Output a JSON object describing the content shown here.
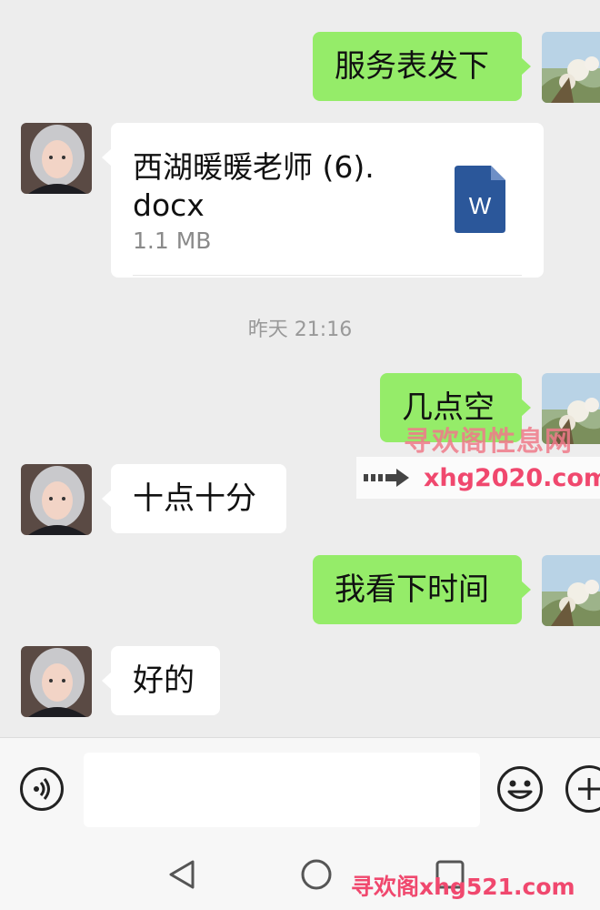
{
  "messages": [
    {
      "side": "right",
      "text": "服务表发下"
    },
    {
      "side": "left",
      "type": "file",
      "file_name": "西湖暖暖老师 (6).\ndocx",
      "file_size": "1.1 MB",
      "file_icon": "word-icon",
      "file_icon_letter": "W"
    },
    {
      "side": "timestamp",
      "text": "昨天 21:16"
    },
    {
      "side": "right",
      "text": "几点空"
    },
    {
      "side": "left",
      "text": "十点十分"
    },
    {
      "side": "right",
      "text": "我看下时间"
    },
    {
      "side": "left",
      "text": "好的"
    }
  ],
  "watermarks": {
    "top_text": "寻欢阁性息网",
    "top_url": "xhg2020.com",
    "bottom_text": "寻欢阁xhg521.com"
  },
  "input_bar": {
    "voice_icon": "voice-icon",
    "emoji_icon": "emoji-icon",
    "plus_icon": "plus-icon",
    "input_value": ""
  },
  "nav": {
    "back_icon": "back-triangle-icon",
    "home_icon": "home-circle-icon",
    "recents_icon": "recents-square-icon"
  },
  "colors": {
    "background": "#ededed",
    "sent_bubble": "#95ec69",
    "received_bubble": "#ffffff",
    "word_blue": "#2b579a",
    "watermark_pink": "#f0486e"
  }
}
